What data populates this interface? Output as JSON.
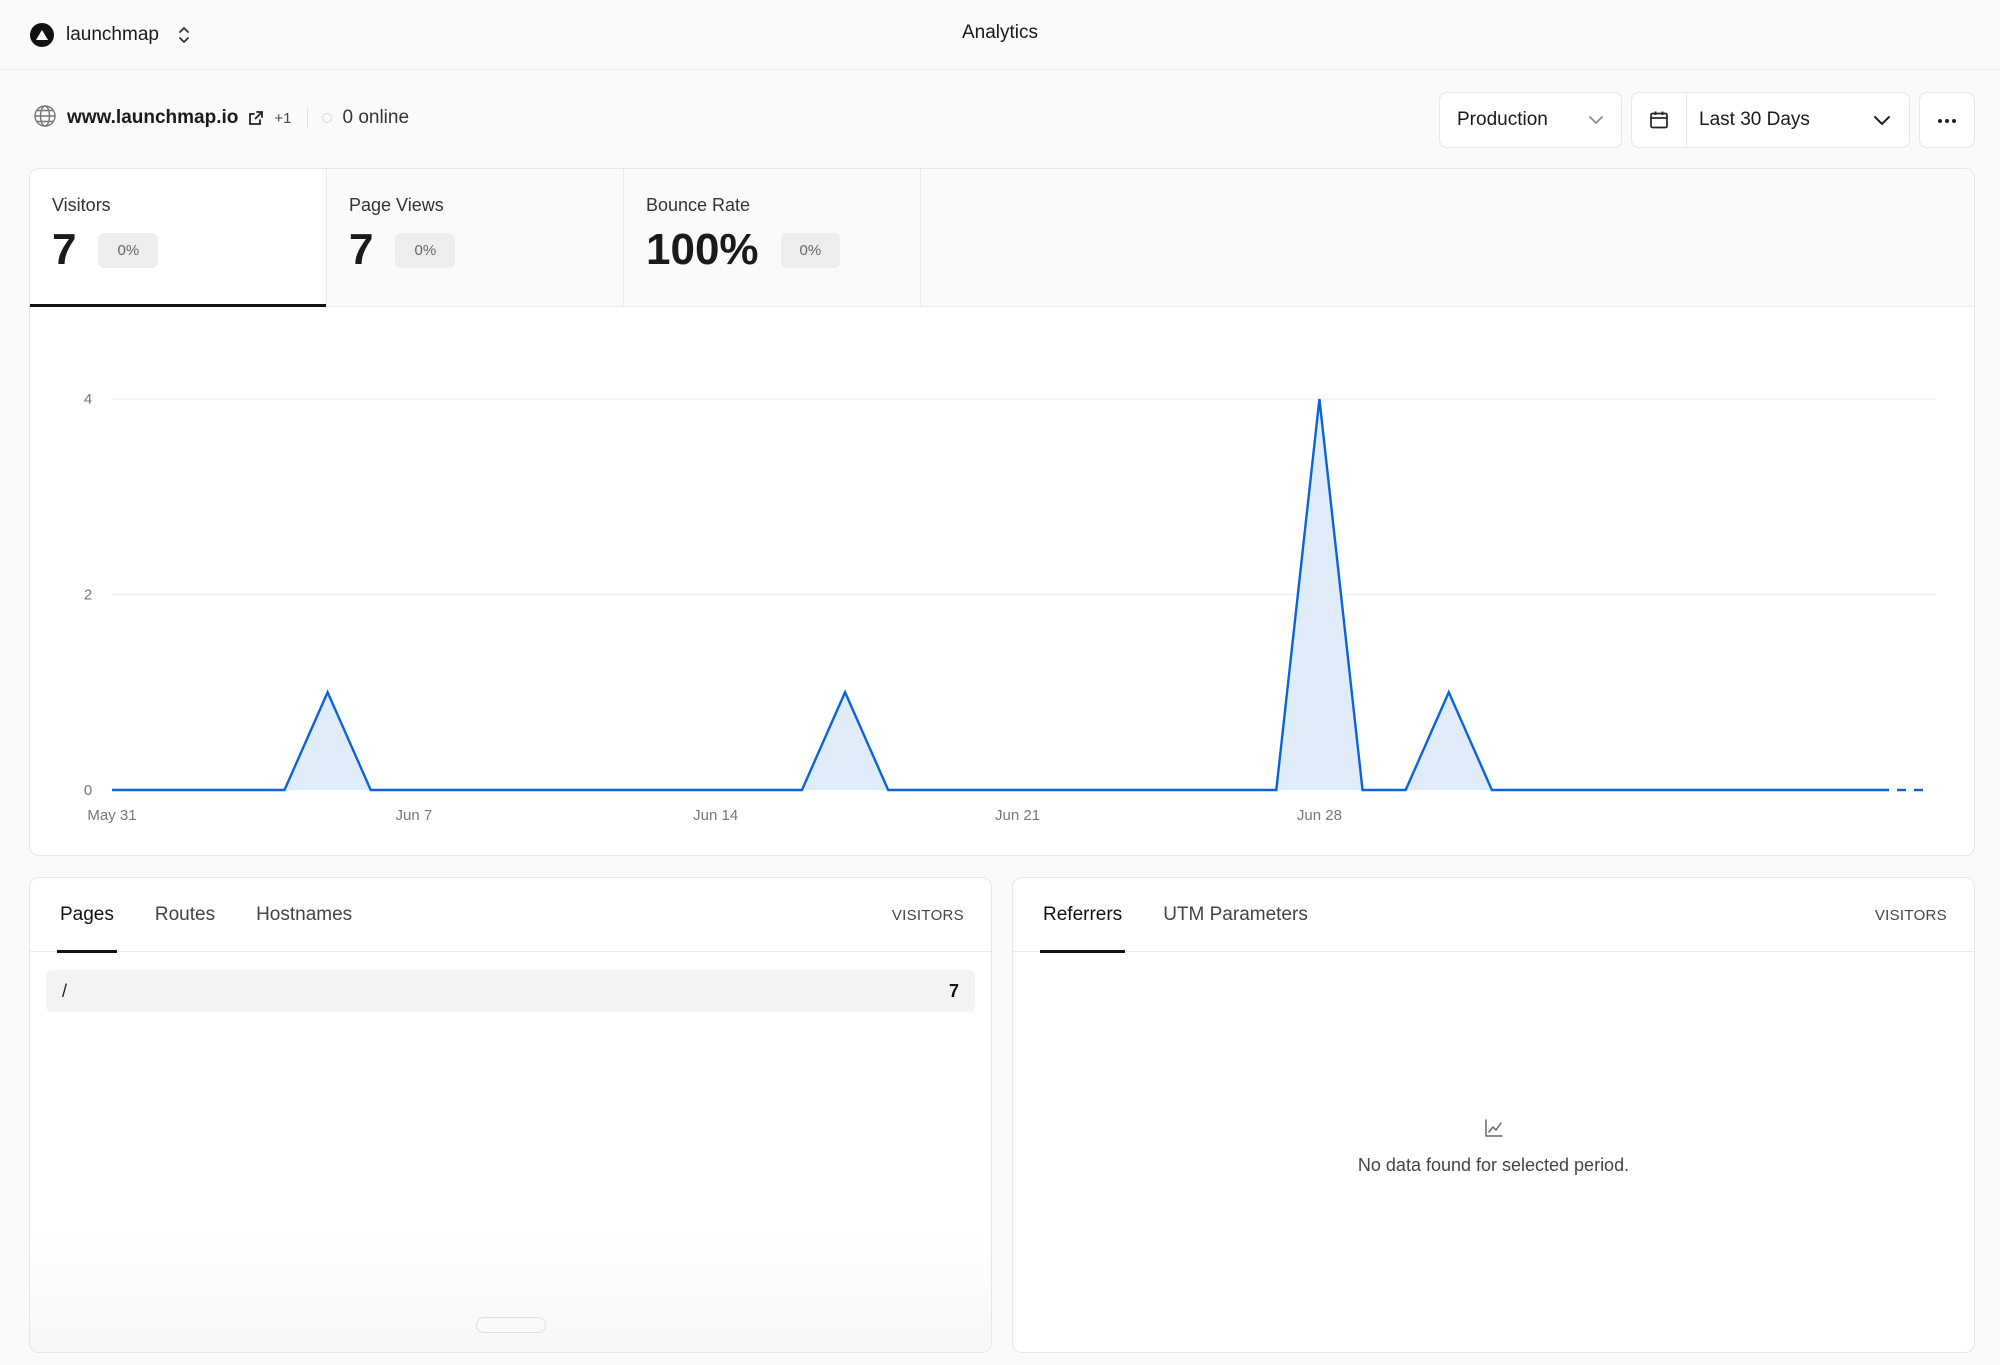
{
  "topbar": {
    "team_name": "launchmap",
    "page_title": "Analytics"
  },
  "site": {
    "url": "www.launchmap.io",
    "extra_domains": "+1",
    "online": "0 online"
  },
  "controls": {
    "environment": "Production",
    "date_range": "Last 30 Days"
  },
  "metrics": [
    {
      "label": "Visitors",
      "value": "7",
      "change": "0%",
      "active": true
    },
    {
      "label": "Page Views",
      "value": "7",
      "change": "0%",
      "active": false
    },
    {
      "label": "Bounce Rate",
      "value": "100%",
      "change": "0%",
      "active": false
    }
  ],
  "chart_data": {
    "type": "area",
    "series": [
      {
        "values": [
          0,
          0,
          0,
          0,
          0,
          1,
          0,
          0,
          0,
          0,
          0,
          0,
          0,
          0,
          0,
          0,
          0,
          1,
          0,
          0,
          0,
          0,
          0,
          0,
          0,
          0,
          0,
          0,
          4,
          0,
          0,
          1,
          0,
          0,
          0,
          0,
          0,
          0,
          0,
          0,
          0,
          0
        ]
      }
    ],
    "x_tick_labels": [
      "May 31",
      "Jun 7",
      "Jun 14",
      "Jun 21",
      "Jun 28"
    ],
    "y_ticks": [
      0,
      2,
      4
    ],
    "ylim": [
      0,
      4
    ],
    "grid": true,
    "line_color": "#0a64d6",
    "fill_color": "#e1ecfb"
  },
  "pages_panel": {
    "tabs": [
      "Pages",
      "Routes",
      "Hostnames"
    ],
    "column": "VISITORS",
    "rows": [
      {
        "label": "/",
        "value": "7"
      }
    ]
  },
  "referrers_panel": {
    "tabs": [
      "Referrers",
      "UTM Parameters"
    ],
    "column": "VISITORS",
    "empty_message": "No data found for selected period."
  }
}
